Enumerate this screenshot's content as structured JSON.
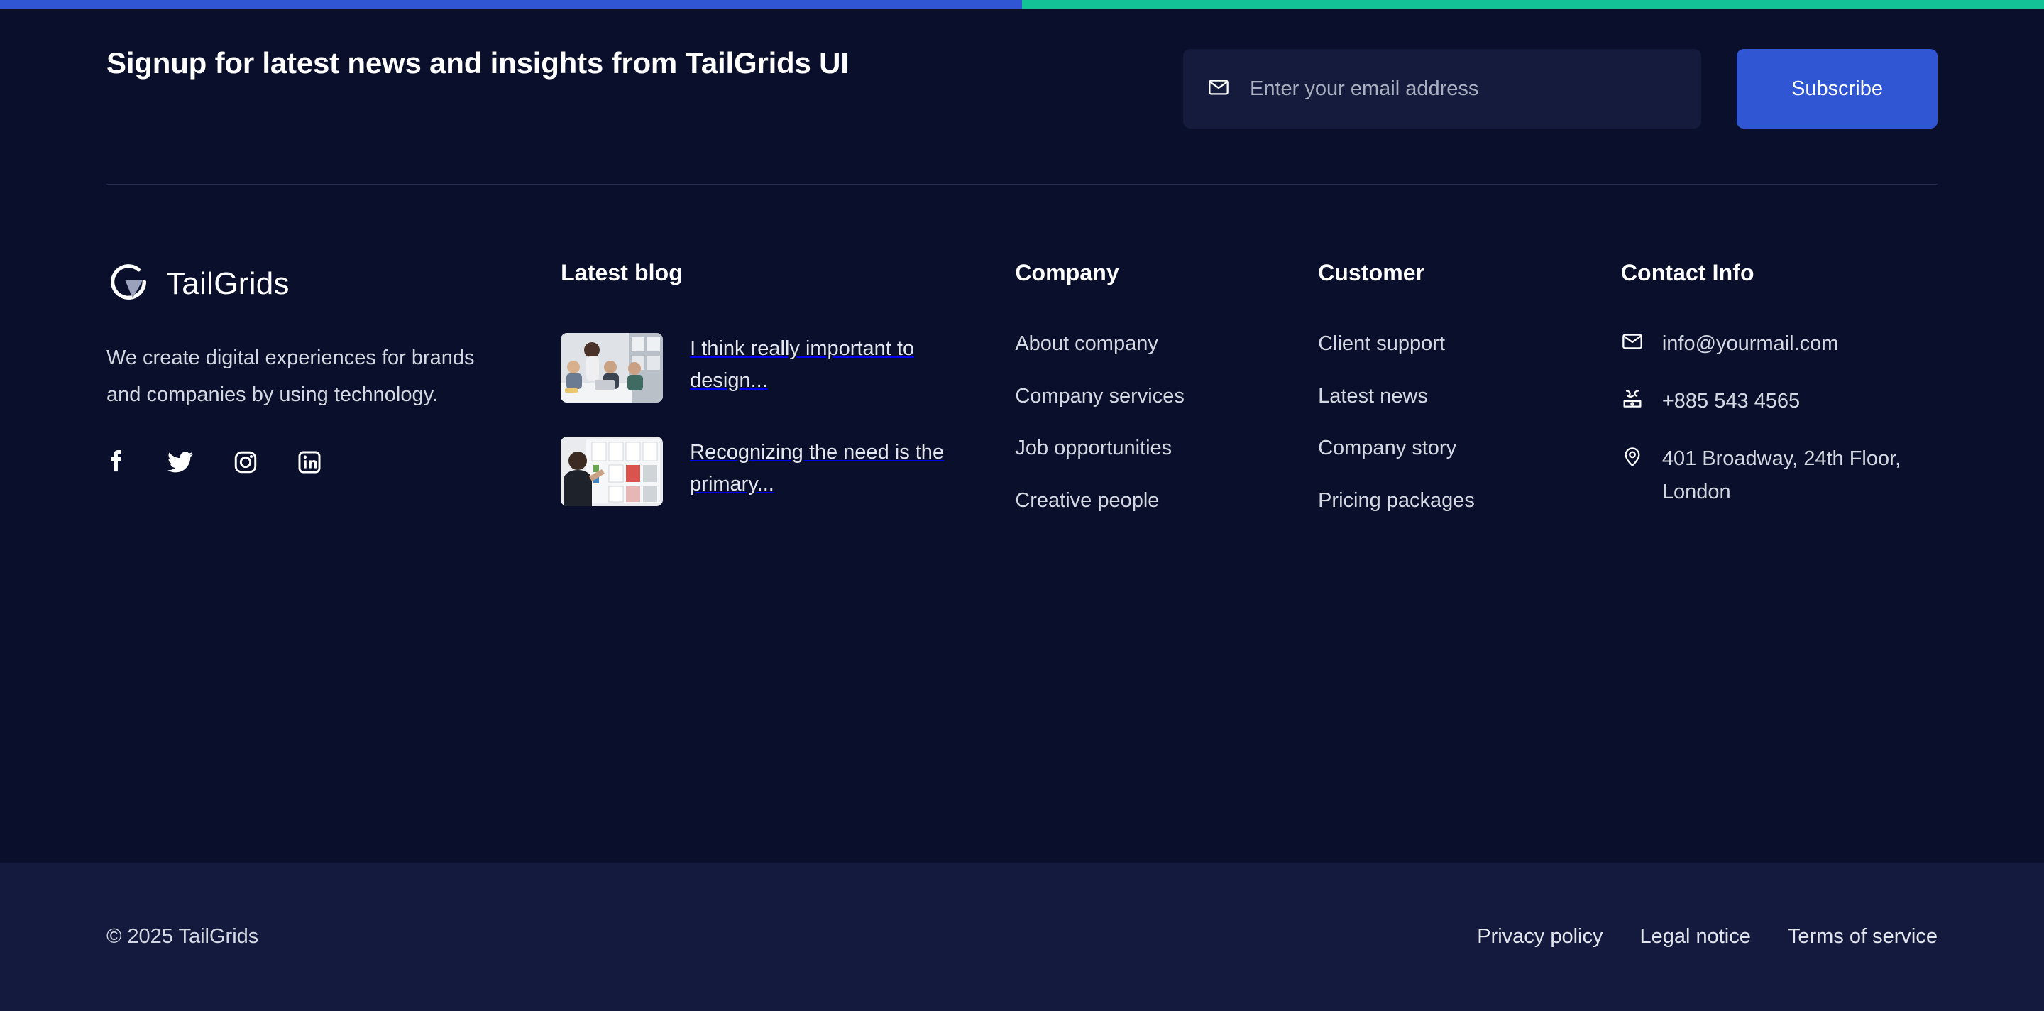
{
  "theme": {
    "background": "#0a0f2c",
    "bottom_bar_background": "#141a3e",
    "accent_blue": "#3056d3",
    "accent_green": "#13c296",
    "input_background": "#151b3d",
    "divider": "#262c52",
    "text_muted": "#d4d8e2"
  },
  "topbar": {
    "left_color": "#3056d3",
    "right_color": "#13c296"
  },
  "signup": {
    "heading": "Signup for latest news and insights from TailGrids UI",
    "email_placeholder": "Enter your email address",
    "email_value": "",
    "mail_icon": "envelope-icon",
    "subscribe_label": "Subscribe"
  },
  "brand": {
    "logo_icon": "tailgrids-g-logo",
    "name": "TailGrids",
    "description": "We create digital experiences for brands and companies by using technology.",
    "socials": [
      {
        "name": "facebook",
        "icon": "facebook-icon"
      },
      {
        "name": "twitter",
        "icon": "twitter-icon"
      },
      {
        "name": "instagram",
        "icon": "instagram-icon"
      },
      {
        "name": "linkedin",
        "icon": "linkedin-icon"
      }
    ]
  },
  "blog": {
    "title": "Latest blog",
    "posts": [
      {
        "title": "I think really important to design...",
        "thumb": "team-meeting-photo"
      },
      {
        "title": "Recognizing the need is the primary...",
        "thumb": "whiteboard-person-photo"
      }
    ]
  },
  "company": {
    "title": "Company",
    "links": [
      "About company",
      "Company services",
      "Job opportunities",
      "Creative people"
    ]
  },
  "customer": {
    "title": "Customer",
    "links": [
      "Client support",
      "Latest news",
      "Company story",
      "Pricing packages"
    ]
  },
  "contact": {
    "title": "Contact Info",
    "items": [
      {
        "icon": "envelope-icon",
        "text": "info@yourmail.com"
      },
      {
        "icon": "telephone-icon",
        "text": "+885 543 4565"
      },
      {
        "icon": "location-pin-icon",
        "text": "401 Broadway, 24th Floor, London"
      }
    ]
  },
  "bottom": {
    "copyright": "© 2025 TailGrids",
    "links": [
      "Privacy policy",
      "Legal notice",
      "Terms of service"
    ]
  }
}
